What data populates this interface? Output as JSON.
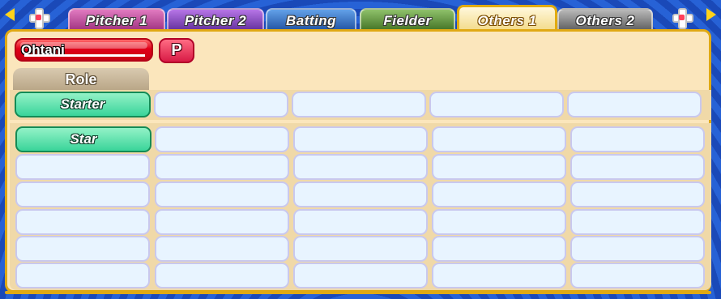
{
  "tabs": [
    "Pitcher 1",
    "Pitcher 2",
    "Batting",
    "Fielder",
    "Others 1",
    "Others 2"
  ],
  "active_tab": "Others 1",
  "player": {
    "name": "Ohtani",
    "position_badge": "P"
  },
  "role_section": {
    "header": "Role",
    "value": "Starter"
  },
  "abilities": {
    "first": "Star"
  },
  "colors": {
    "active_tab": "#f1d57a",
    "selected_cell": "#3ad49a",
    "panel": "#fbe6bc"
  }
}
